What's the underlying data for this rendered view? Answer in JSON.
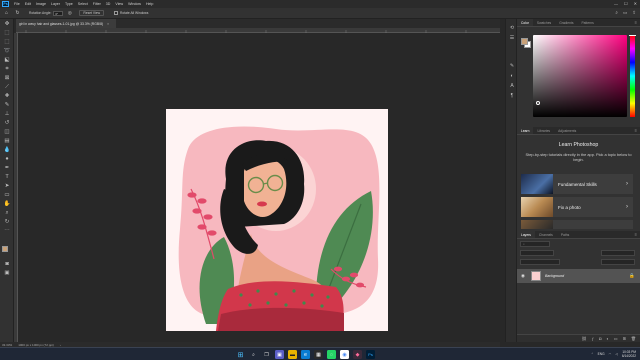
{
  "app": {
    "logo": "Ps"
  },
  "menu": [
    "File",
    "Edit",
    "Image",
    "Layer",
    "Type",
    "Select",
    "Filter",
    "3D",
    "View",
    "Window",
    "Help"
  ],
  "window_controls": [
    "—",
    "☐",
    "✕"
  ],
  "options": {
    "rotation_label": "Rotation Angle:",
    "rotation_value": "0°",
    "reset_view": "Reset View",
    "rotate_all": "Rotate All Windows"
  },
  "document": {
    "tab_title": "girl in wavy hair and glasses-1-01.jpg @ 33.3% (RGB/8)",
    "close": "×"
  },
  "panels": {
    "color_tabs": [
      "Color",
      "Swatches",
      "Gradients",
      "Patterns"
    ],
    "fg_color": "#c9a178",
    "learn_tabs": [
      "Learn",
      "Libraries",
      "Adjustments"
    ],
    "learn_title": "Learn Photoshop",
    "learn_desc": "Step-by-step tutorials directly in the app. Pick a topic below to begin.",
    "learn_cards": [
      {
        "label": "Fundamental Skills",
        "chevron": "›"
      },
      {
        "label": "Fix a photo",
        "chevron": "›"
      }
    ],
    "layers_tabs": [
      "Layers",
      "Channels",
      "Paths"
    ],
    "layer_name": "Background",
    "menu_icon": "≡"
  },
  "status": {
    "zoom": "33.33%",
    "doc_size": "1000 px x 1000 px (72 ppi)",
    "arrow": "›"
  },
  "taskbar": {
    "time": "10:03 PM",
    "date": "6/14/2022",
    "lang": "ENG"
  }
}
